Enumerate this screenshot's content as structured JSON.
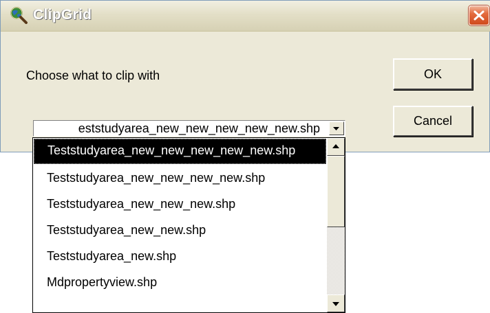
{
  "window": {
    "title": "ClipGrid",
    "icon": "globe-magnifier-icon",
    "close_icon": "close-icon",
    "close_color": "#e05a2b"
  },
  "dialog": {
    "prompt": "Choose what to clip with",
    "ok_label": "OK",
    "cancel_label": "Cancel"
  },
  "combo": {
    "selected_value": "Teststudyarea_new_new_new_new_new.shp",
    "visible_text": "eststudyarea_new_new_new_new_new.shp"
  },
  "list": {
    "items": [
      "Teststudyarea_new_new_new_new_new.shp",
      "Teststudyarea_new_new_new_new.shp",
      "Teststudyarea_new_new_new.shp",
      "Teststudyarea_new_new.shp",
      "Teststudyarea_new.shp",
      "Mdpropertyview.shp"
    ],
    "selected_index": 0,
    "highlight_color": "#000000"
  }
}
